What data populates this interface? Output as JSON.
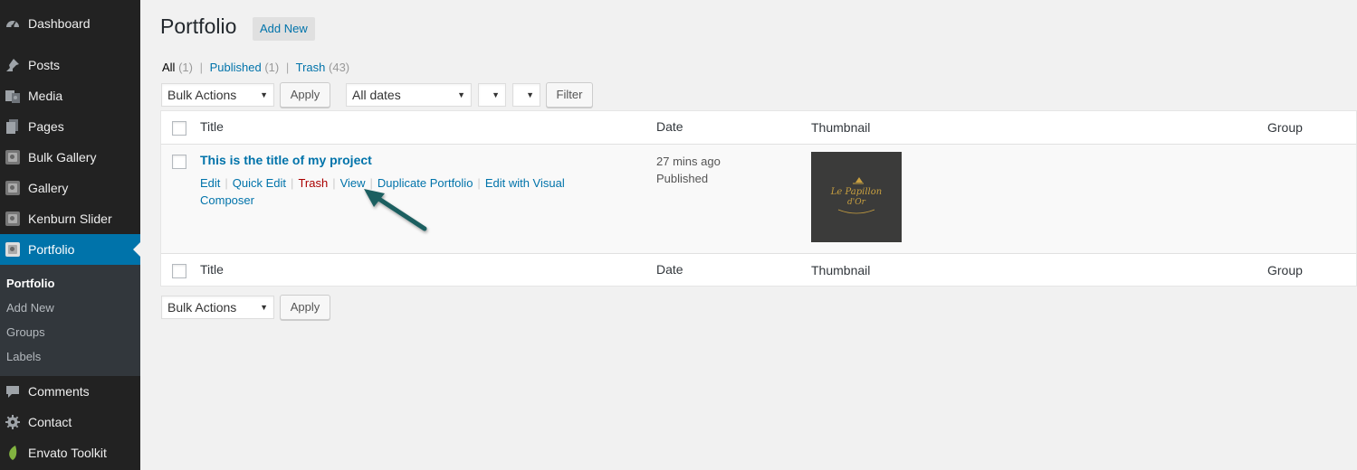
{
  "sidebar": {
    "menu": [
      {
        "label": "Dashboard",
        "icon": "dashboard-icon"
      },
      {
        "label": "Posts",
        "icon": "pin-icon"
      },
      {
        "label": "Media",
        "icon": "media-icon"
      },
      {
        "label": "Pages",
        "icon": "pages-icon"
      },
      {
        "label": "Bulk Gallery",
        "icon": "gallery-icon"
      },
      {
        "label": "Gallery",
        "icon": "gallery-icon"
      },
      {
        "label": "Kenburn Slider",
        "icon": "gallery-icon"
      },
      {
        "label": "Portfolio",
        "icon": "gallery-icon"
      },
      {
        "label": "Comments",
        "icon": "comment-icon"
      },
      {
        "label": "Contact",
        "icon": "gear-icon"
      },
      {
        "label": "Envato Toolkit",
        "icon": "leaf-icon"
      }
    ],
    "submenu": [
      "Portfolio",
      "Add New",
      "Groups",
      "Labels"
    ]
  },
  "header": {
    "title": "Portfolio",
    "add_new": "Add New"
  },
  "filters": {
    "all": "All",
    "all_count": "(1)",
    "published": "Published",
    "published_count": "(1)",
    "trash": "Trash",
    "trash_count": "(43)"
  },
  "toolbar": {
    "bulk_actions": "Bulk Actions",
    "apply": "Apply",
    "all_dates": "All dates",
    "filter": "Filter"
  },
  "table": {
    "columns": [
      "Title",
      "Date",
      "Thumbnail",
      "Group"
    ],
    "row": {
      "title": "This is the title of my project",
      "date_ago": "27 mins ago",
      "status": "Published",
      "thumbnail_text": [
        "Le Papillon",
        "d'Or"
      ],
      "actions": {
        "edit": "Edit",
        "quick_edit": "Quick Edit",
        "trash": "Trash",
        "view": "View",
        "duplicate": "Duplicate Portfolio",
        "edit_visual": "Edit with Visual Composer"
      }
    }
  },
  "colors": {
    "accent": "#0073aa",
    "sidebar_bg": "#222222",
    "trash_link": "#aa0000",
    "arrow": "#1f5f61"
  }
}
